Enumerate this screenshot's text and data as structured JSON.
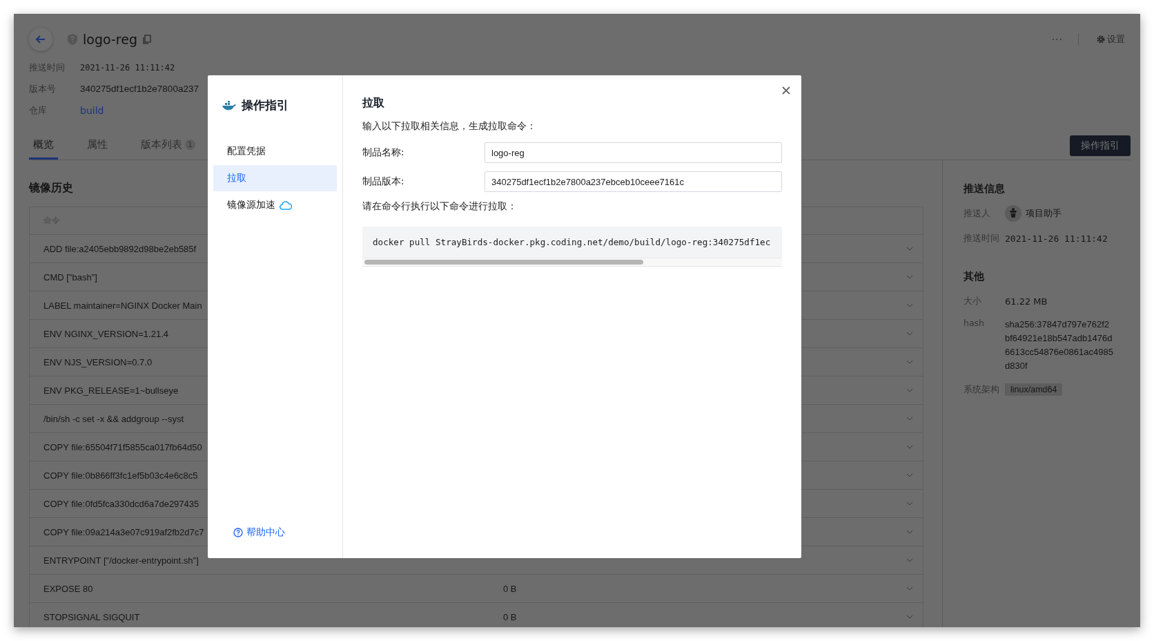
{
  "header": {
    "title": "logo-reg",
    "more": "···",
    "settings": "设置"
  },
  "meta": [
    {
      "label": "推送时间",
      "value": "2021-11-26 11:11:42",
      "kind": "mono"
    },
    {
      "label": "版本号",
      "value": "340275df1ecf1b2e7800a237",
      "kind": "text"
    },
    {
      "label": "仓库",
      "value": "build",
      "kind": "link"
    }
  ],
  "tabs": [
    {
      "label": "概览",
      "selected": true
    },
    {
      "label": "属性",
      "selected": false
    },
    {
      "label": "版本列表",
      "badge": "1",
      "selected": false
    }
  ],
  "guide_button": "操作指引",
  "history": {
    "title": "镜像历史",
    "columns": [
      "命令"
    ],
    "rows": [
      {
        "command": "ADD file:a2405ebb9892d98be2eb585f"
      },
      {
        "command": "CMD [\"bash\"]"
      },
      {
        "command": "LABEL maintainer=NGINX Docker Main"
      },
      {
        "command": "ENV NGINX_VERSION=1.21.4"
      },
      {
        "command": "ENV NJS_VERSION=0.7.0"
      },
      {
        "command": "ENV PKG_RELEASE=1~bullseye"
      },
      {
        "command": "/bin/sh -c set -x && addgroup --syst"
      },
      {
        "command": "COPY file:65504f71f5855ca017fb64d50"
      },
      {
        "command": "COPY file:0b866ff3fc1ef5b03c4e6c8c5"
      },
      {
        "command": "COPY file:0fd5fca330dcd6a7de297435"
      },
      {
        "command": "COPY file:09a214a3e07c919af2fb2d7c7"
      },
      {
        "command": "ENTRYPOINT [\"/docker-entrypoint.sh\"]"
      },
      {
        "command": "EXPOSE 80",
        "size": "0 B"
      },
      {
        "command": "STOPSIGNAL SIGQUIT",
        "size": "0 B"
      }
    ]
  },
  "push_info": {
    "title": "推送信息",
    "pusher_label": "推送人",
    "pusher": "项目助手",
    "time_label": "推送时间",
    "time": "2021-11-26 11:11:42"
  },
  "other": {
    "title": "其他",
    "size_label": "大小",
    "size": "61.22 MB",
    "hash_label": "hash",
    "hash": [
      "sha256:37847d797e762f2",
      "bf64921e18b547adb1476d",
      "6613cc54876e0861ac4985",
      "d830f"
    ],
    "arch_label": "系统架构",
    "arch": "linux/amd64"
  },
  "modal": {
    "title": "操作指引",
    "nav": [
      {
        "label": "配置凭据",
        "selected": false
      },
      {
        "label": "拉取",
        "selected": true,
        "kind": "plain"
      },
      {
        "label": "镜像源加速",
        "selected": false,
        "kind": "cloud"
      }
    ],
    "help": "帮助中心",
    "heading": "拉取",
    "intro": "输入以下拉取相关信息，生成拉取命令：",
    "fields": [
      {
        "label": "制品名称:",
        "value": "logo-reg"
      },
      {
        "label": "制品版本:",
        "value": "340275df1ecf1b2e7800a237ebceb10ceee7161c"
      }
    ],
    "command_intro": "请在命令行执行以下命令进行拉取：",
    "command": "docker pull StrayBirds-docker.pkg.coding.net/demo/build/logo-reg:340275df1ec"
  }
}
